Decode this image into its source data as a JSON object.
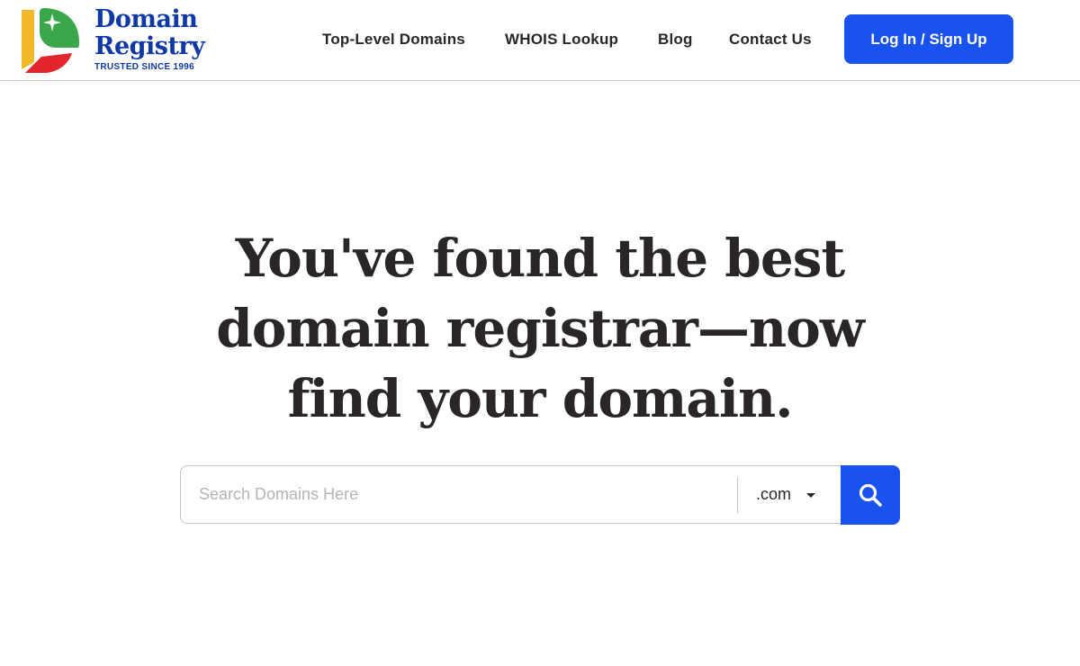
{
  "brand": {
    "name_line1": "Domain",
    "name_line2": "Registry",
    "tagline": "TRUSTED SINCE 1996",
    "colors": {
      "blue": "#0f3aa6",
      "green": "#3aa84a",
      "red": "#e3262b",
      "yellow": "#f4b928"
    }
  },
  "nav": {
    "items": [
      {
        "label": "Top-Level Domains"
      },
      {
        "label": "WHOIS Lookup"
      },
      {
        "label": "Blog"
      },
      {
        "label": "Contact Us"
      }
    ],
    "login_label": "Log In / Sign Up"
  },
  "hero": {
    "lines": [
      "You've found the best",
      "domain registrar—now",
      "find your domain."
    ]
  },
  "search": {
    "placeholder": "Search Domains Here",
    "value": "",
    "tld_selected": ".com",
    "button_icon": "search-icon"
  },
  "colors": {
    "accent": "#1a52f0",
    "text": "#2a2626"
  }
}
